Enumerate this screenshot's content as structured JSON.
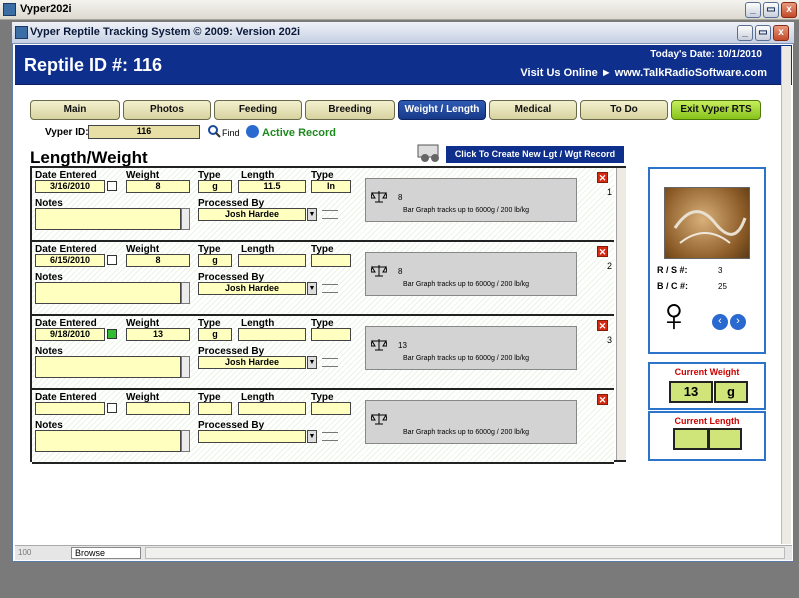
{
  "window": {
    "title": "Vyper202i",
    "controls": [
      "_",
      "▭",
      "x"
    ]
  },
  "app": {
    "title": "Vyper Reptile Tracking System © 2009: Version 202i"
  },
  "header": {
    "title": "Reptile ID #: 116",
    "todays_date": "Today's Date: 10/1/2010",
    "website": "Visit Us Online ► www.TalkRadioSoftware.com"
  },
  "tabs": [
    "Main",
    "Photos",
    "Feeding",
    "Breeding",
    "Weight / Length",
    "Medical",
    "To Do",
    "Exit Vyper RTS"
  ],
  "vyper_id": {
    "label": "Vyper ID:",
    "value": "116",
    "find": "Find",
    "active": "Active Record"
  },
  "section": {
    "title": "Length/Weight",
    "create_button": "Click To Create New Lgt / Wgt Record"
  },
  "labels": {
    "date": "Date Entered",
    "weight": "Weight",
    "type": "Type",
    "length": "Length",
    "type2": "Type",
    "notes": "Notes",
    "processed": "Processed By",
    "graph_note": "Bar Graph tracks up to 6000g / 200 lb/kg"
  },
  "records": [
    {
      "date": "3/16/2010",
      "weight": "8",
      "wtype": "g",
      "length": "11.5",
      "ltype": "In",
      "processed": "Josh Hardee",
      "graph_value": "8",
      "index": "1"
    },
    {
      "date": "6/15/2010",
      "weight": "8",
      "wtype": "g",
      "length": "",
      "ltype": "",
      "processed": "Josh Hardee",
      "graph_value": "8",
      "index": "2"
    },
    {
      "date": "9/18/2010",
      "weight": "13",
      "wtype": "g",
      "length": "",
      "ltype": "",
      "processed": "Josh Hardee",
      "graph_value": "13",
      "index": "3"
    },
    {
      "date": "",
      "weight": "",
      "wtype": "",
      "length": "",
      "ltype": "",
      "processed": "",
      "graph_value": "",
      "index": ""
    }
  ],
  "sidebar": {
    "rs_label": "R / S #:",
    "rs_value": "3",
    "bc_label": "B / C #:",
    "bc_value": "25",
    "gender_symbol": "♀",
    "current_weight_label": "Current Weight",
    "current_weight_value": "13",
    "current_weight_unit": "g",
    "current_length_label": "Current Length"
  },
  "statusbar": {
    "zoom": "100",
    "mode": "Browse"
  },
  "colors": {
    "banner": "#0e2f8c",
    "active_tab": "#17398a",
    "exit_tab": "#86c21a",
    "field": "#ffffc0"
  }
}
